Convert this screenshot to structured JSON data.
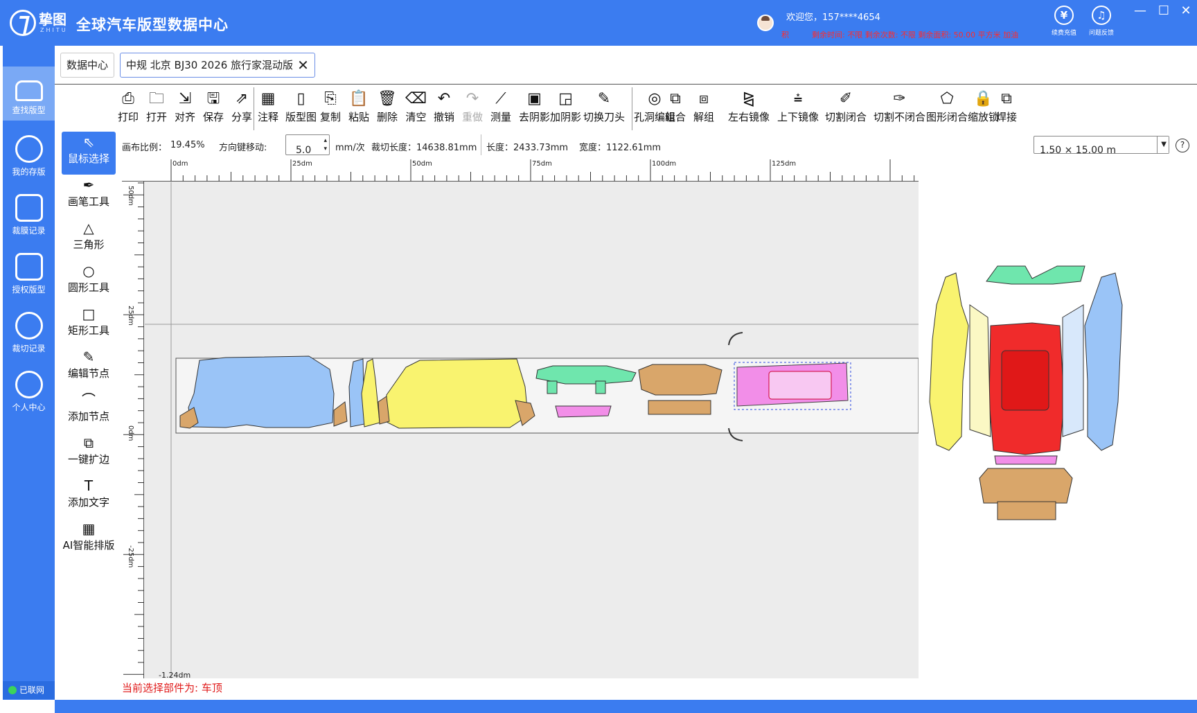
{
  "header": {
    "logo_name": "挚图",
    "logo_sub": "ZHITU",
    "title": "全球汽车版型数据中心",
    "welcome": "欢迎您，157****4654",
    "quota_prefix": "积",
    "quota": "剩余时间: 不限 剩余次数: 不限 剩余面积: 50.00 平方米 加油",
    "buttons": [
      {
        "label": "续费充值",
        "icon": "yen-icon"
      },
      {
        "label": "问题反馈",
        "icon": "headset-icon"
      }
    ],
    "window_controls": [
      "—",
      "☐",
      "✕"
    ]
  },
  "rail": {
    "items": [
      {
        "label": "查找版型",
        "icon": "car-icon",
        "active": true
      },
      {
        "label": "我的存版",
        "icon": "user-search-icon",
        "active": false
      },
      {
        "label": "裁膜记录",
        "icon": "list-icon",
        "active": false
      },
      {
        "label": "授权版型",
        "icon": "share-icon",
        "active": false
      },
      {
        "label": "裁切记录",
        "icon": "download-icon",
        "active": false
      },
      {
        "label": "个人中心",
        "icon": "person-icon",
        "active": false
      }
    ],
    "network_status": "已联网"
  },
  "tabs": [
    {
      "label": "数据中心",
      "active": false
    },
    {
      "label": "中规 北京 BJ30 2026 旅行家混动版",
      "active": true
    }
  ],
  "toolbar": [
    {
      "label": "打印",
      "glyph": "⎙",
      "icon": "print-icon"
    },
    {
      "label": "打开",
      "glyph": "🗀",
      "icon": "open-folder-icon"
    },
    {
      "label": "对齐",
      "glyph": "⇲",
      "icon": "align-icon"
    },
    {
      "label": "保存",
      "glyph": "🖫",
      "icon": "save-icon"
    },
    {
      "label": "分享",
      "glyph": "⇗",
      "icon": "share-icon"
    },
    {
      "label": "注释",
      "glyph": "▦",
      "icon": "annotate-icon"
    },
    {
      "label": "版型图",
      "glyph": "▯",
      "icon": "pattern-icon"
    },
    {
      "label": "复制",
      "glyph": "⎘",
      "icon": "copy-icon"
    },
    {
      "label": "粘贴",
      "glyph": "📋",
      "icon": "paste-icon"
    },
    {
      "label": "删除",
      "glyph": "🗑",
      "icon": "delete-icon"
    },
    {
      "label": "清空",
      "glyph": "⌫",
      "icon": "clear-icon"
    },
    {
      "label": "撤销",
      "glyph": "↶",
      "icon": "undo-icon"
    },
    {
      "label": "重做",
      "glyph": "↷",
      "icon": "redo-icon",
      "disabled": true
    },
    {
      "label": "测量",
      "glyph": "⟋",
      "icon": "measure-icon"
    },
    {
      "label": "去阴影",
      "glyph": "▣",
      "icon": "remove-shadow-icon"
    },
    {
      "label": "加阴影",
      "glyph": "◲",
      "icon": "add-shadow-icon"
    },
    {
      "label": "切换刀头",
      "glyph": "✎",
      "icon": "blade-icon"
    },
    {
      "label": "孔洞编辑",
      "glyph": "◎",
      "icon": "hole-edit-icon"
    },
    {
      "label": "组合",
      "glyph": "⧉",
      "icon": "group-icon"
    },
    {
      "label": "解组",
      "glyph": "⧈",
      "icon": "ungroup-icon"
    },
    {
      "label": "左右镜像",
      "glyph": "⧎",
      "icon": "mirror-h-icon"
    },
    {
      "label": "上下镜像",
      "glyph": "⩮",
      "icon": "mirror-v-icon"
    },
    {
      "label": "切割闭合",
      "glyph": "✐",
      "icon": "cut-close-icon"
    },
    {
      "label": "切割不闭合",
      "glyph": "✑",
      "icon": "cut-open-icon"
    },
    {
      "label": "图形闭合",
      "glyph": "⬠",
      "icon": "shape-close-icon"
    },
    {
      "label": "缩放锁",
      "glyph": "🔒",
      "icon": "scale-lock-icon"
    },
    {
      "label": "焊接",
      "glyph": "⧉",
      "icon": "weld-icon"
    }
  ],
  "tools": [
    {
      "label": "鼠标选择",
      "glyph": "⇖",
      "icon": "cursor-icon",
      "active": true
    },
    {
      "label": "画笔工具",
      "glyph": "✒",
      "icon": "pen-icon"
    },
    {
      "label": "三角形",
      "glyph": "△",
      "icon": "triangle-icon"
    },
    {
      "label": "圆形工具",
      "glyph": "○",
      "icon": "circle-icon"
    },
    {
      "label": "矩形工具",
      "glyph": "□",
      "icon": "rect-icon"
    },
    {
      "label": "编辑节点",
      "glyph": "✎",
      "icon": "edit-node-icon"
    },
    {
      "label": "添加节点",
      "glyph": "⌒",
      "icon": "add-node-icon"
    },
    {
      "label": "一键扩边",
      "glyph": "⧉",
      "icon": "expand-icon"
    },
    {
      "label": "添加文字",
      "glyph": "T",
      "icon": "text-icon"
    },
    {
      "label": "AI智能排版",
      "glyph": "▦",
      "icon": "ai-layout-icon"
    }
  ],
  "info": {
    "scale_label": "画布比例：",
    "scale_value": "19.45%",
    "arrow_label": "方向键移动:",
    "arrow_value": "5.0",
    "arrow_unit": "mm/次",
    "cut_length": "裁切长度：14638.81mm",
    "length": "长度：2433.73mm",
    "width": "宽度：1122.61mm",
    "material": "1.50 × 15.00 m"
  },
  "ruler": {
    "h_labels": [
      "0dm",
      "25dm",
      "50dm",
      "75dm",
      "100dm",
      "125dm"
    ],
    "v_labels": [
      "50dm",
      "25dm",
      "0dm",
      "-25dm"
    ],
    "corner_readout": "-1.24dm"
  },
  "status": "当前选择部件为: 车顶",
  "colors": {
    "header": "#3b7cf0",
    "blue_part": "#9ac4f7",
    "yellow_part": "#f9f36f",
    "green_part": "#6fe6ad",
    "tan_part": "#d9a66a",
    "pink_part": "#f28ee8",
    "red_part": "#f02b2b"
  }
}
